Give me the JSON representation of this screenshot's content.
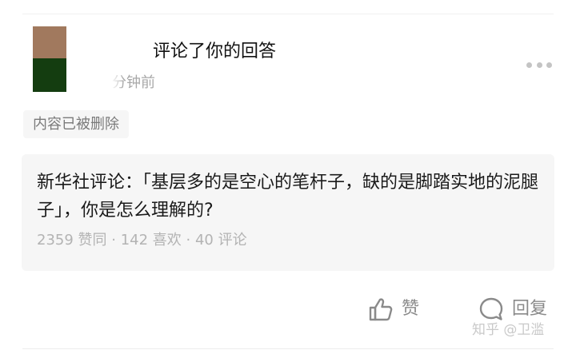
{
  "notification": {
    "action_text": "评论了你的回答",
    "time_text": "分钟前",
    "deleted_label": "内容已被删除"
  },
  "question": {
    "title": "新华社评论：「基层多的是空心的笔杆子，缺的是脚踏实地的泥腿子」，你是怎么理解的?",
    "stats": "2359 赞同 · 142 喜欢 · 40 评论"
  },
  "actions": {
    "like_label": "赞",
    "reply_label": "回复"
  },
  "watermark": "知乎 @卫滥",
  "icons": {
    "more": "more-dots-icon",
    "like": "thumbs-up-icon",
    "reply": "comment-bubble-icon"
  },
  "colors": {
    "primary_text": "#121212",
    "muted_text": "#a8a8a8",
    "card_bg": "#f6f6f6",
    "icon_gray": "#8a8a8a"
  }
}
